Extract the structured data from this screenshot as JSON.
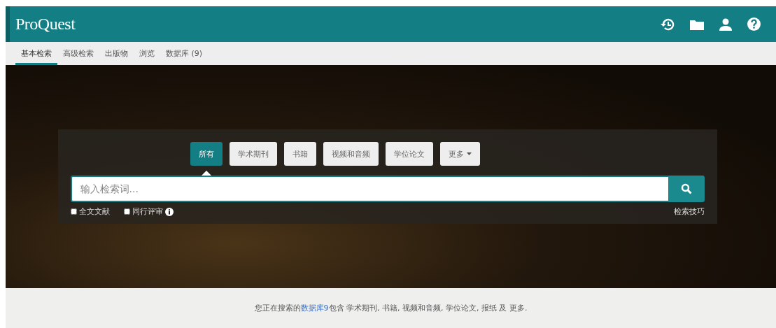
{
  "header": {
    "logo": "ProQuest"
  },
  "nav": [
    {
      "label": "基本检索",
      "selected": true
    },
    {
      "label": "高级检索",
      "selected": false
    },
    {
      "label": "出版物",
      "selected": false
    },
    {
      "label": "浏览",
      "selected": false
    },
    {
      "label": "数据库 (9)",
      "selected": false
    }
  ],
  "search": {
    "source_tabs": [
      {
        "label": "所有",
        "selected": true,
        "kind": "tab"
      },
      {
        "label": "学术期刊",
        "selected": false,
        "kind": "tab"
      },
      {
        "label": "书籍",
        "selected": false,
        "kind": "tab"
      },
      {
        "label": "视频和音频",
        "selected": false,
        "kind": "tab"
      },
      {
        "label": "学位论文",
        "selected": false,
        "kind": "tab"
      },
      {
        "label": "更多",
        "selected": false,
        "kind": "dropdown"
      }
    ],
    "placeholder": "输入检索词...",
    "options": [
      {
        "label": "全文文献",
        "checked": false,
        "info": false
      },
      {
        "label": "同行评审",
        "checked": false,
        "info": true
      }
    ],
    "tips_link": "检索技巧"
  },
  "footer": {
    "before": "您正在搜索的",
    "link": "数据库9",
    "after": "包含 学术期刊, 书籍, 视频和音频, 学位论文, 报纸 及 更多."
  }
}
